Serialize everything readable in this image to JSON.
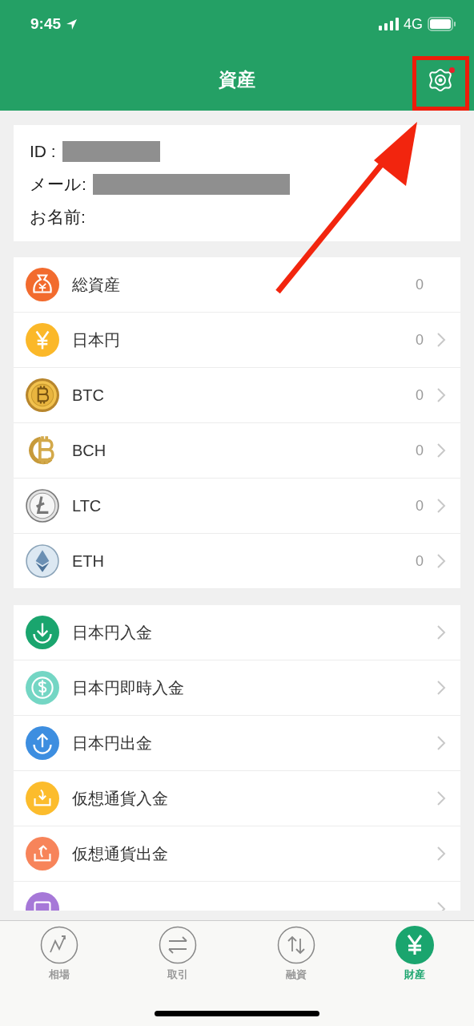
{
  "status_bar": {
    "time": "9:45",
    "network": "4G"
  },
  "header": {
    "title": "資産",
    "settings_badge": true
  },
  "profile": [
    {
      "label": "ID :",
      "redacted": true
    },
    {
      "label": "メール:",
      "redacted": true
    },
    {
      "label": "お名前:",
      "redacted": false
    }
  ],
  "assets": [
    {
      "kind": "total",
      "name": "総資産",
      "value": "0",
      "chevron": false
    },
    {
      "kind": "yen",
      "name": "日本円",
      "value": "0",
      "chevron": true
    },
    {
      "kind": "btc",
      "name": "BTC",
      "value": "0",
      "chevron": true
    },
    {
      "kind": "bch",
      "name": "BCH",
      "value": "0",
      "chevron": true
    },
    {
      "kind": "ltc",
      "name": "LTC",
      "value": "0",
      "chevron": true
    },
    {
      "kind": "eth",
      "name": "ETH",
      "value": "0",
      "chevron": true
    }
  ],
  "actions": [
    {
      "kind": "down",
      "label": "日本円入金",
      "color": "#1aa56e"
    },
    {
      "kind": "dollar",
      "label": "日本円即時入金",
      "color": "#74d6c4"
    },
    {
      "kind": "up",
      "label": "日本円出金",
      "color": "#3d8ee0"
    },
    {
      "kind": "tray-in",
      "label": "仮想通貨入金",
      "color": "#fcbc2c"
    },
    {
      "kind": "tray-out",
      "label": "仮想通貨出金",
      "color": "#f7845a"
    },
    {
      "kind": "card",
      "color": "#a678d8"
    }
  ],
  "tabs": [
    {
      "kind": "chart",
      "label": "相場",
      "selected": false
    },
    {
      "kind": "swap",
      "label": "取引",
      "selected": false
    },
    {
      "kind": "loan",
      "label": "融資",
      "selected": false
    },
    {
      "kind": "yen",
      "label": "財産",
      "selected": true
    }
  ],
  "annotation": {
    "highlight_settings": true
  }
}
